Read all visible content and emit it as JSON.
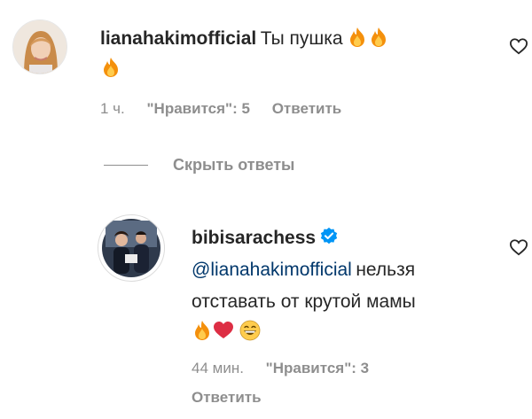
{
  "comments": [
    {
      "username": "lianahakimofficial",
      "text": "Ты пушка",
      "emojis": [
        "fire-emoji",
        "fire-emoji",
        "fire-emoji"
      ],
      "time": "1 ч.",
      "likes": "\"Нравится\": 5",
      "reply_label": "Ответить"
    }
  ],
  "replies_toggle": {
    "label": "Скрыть ответы"
  },
  "replies": [
    {
      "username": "bibisarachess",
      "verified": true,
      "mention": "@lianahakimofficial",
      "text_line1": "нельзя",
      "text_line2": "отставать от крутой мамы",
      "emojis": [
        "fire-emoji",
        "red-heart-emoji",
        "grinning-face-emoji"
      ],
      "time": "44 мин.",
      "likes": "\"Нравится\": 3",
      "reply_label": "Ответить"
    }
  ],
  "colors": {
    "text": "#262626",
    "secondary": "#8e8e8e",
    "link": "#00376b",
    "verified": "#0095f6",
    "heart": "#ed4956"
  }
}
